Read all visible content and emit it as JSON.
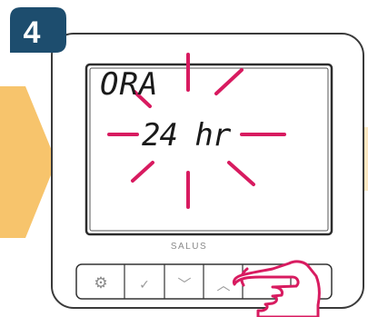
{
  "step_number": "4",
  "display": {
    "label": "ORA",
    "value": "24 hr"
  },
  "brand": "SALUS",
  "buttons": [
    {
      "icon": "gear-icon",
      "glyph": "⚙"
    },
    {
      "icon": "check-icon",
      "glyph": "✓"
    },
    {
      "icon": "chevron-down-icon",
      "glyph": "﹀"
    },
    {
      "icon": "chevron-up-icon",
      "glyph": "︿"
    }
  ],
  "colors": {
    "step_badge": "#1d4d6e",
    "arrow": "#f7c46c",
    "accent": "#d81b60",
    "device_border": "#3a3a3a",
    "screen_border": "#2c2c2c"
  }
}
